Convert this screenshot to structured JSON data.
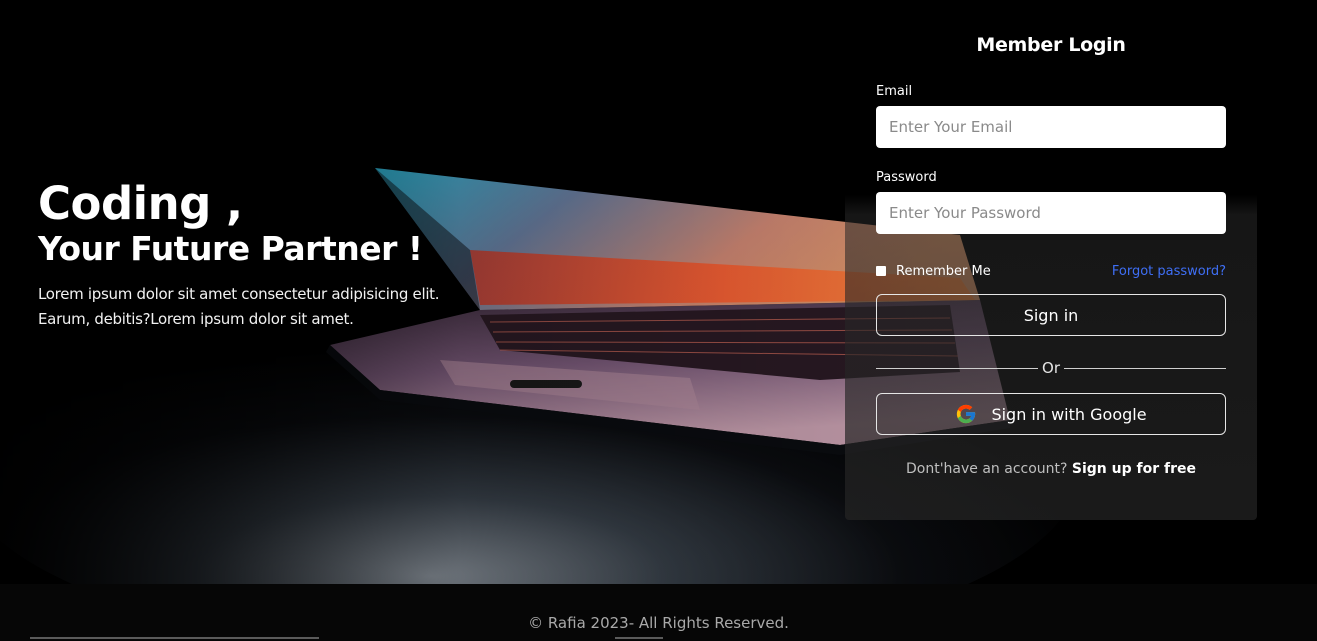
{
  "hero": {
    "title_line1": "Coding ,",
    "title_line2": "Your Future Partner !",
    "description_line1": "Lorem ipsum dolor sit amet consectetur adipisicing elit.",
    "description_line2": "Earum, debitis?Lorem ipsum dolor sit amet."
  },
  "login": {
    "title": "Member Login",
    "email_label": "Email",
    "email_placeholder": "Enter Your Email",
    "email_value": "",
    "password_label": "Password",
    "password_placeholder": "Enter Your Password",
    "password_value": "",
    "remember_label": "Remember Me",
    "remember_checked": false,
    "forgot_label": "Forgot password?",
    "signin_label": "Sign in",
    "divider_label": "Or",
    "google_label": "Sign in with Google",
    "google_icon": "google-g-icon",
    "signup_prompt": "Dont'have an account?",
    "signup_link": "Sign up for free"
  },
  "footer": {
    "copyright": "© Rafia 2023- All Rights Reserved."
  },
  "colors": {
    "background": "#000000",
    "link_blue": "#3f6ff5",
    "input_bg": "#ffffff"
  }
}
